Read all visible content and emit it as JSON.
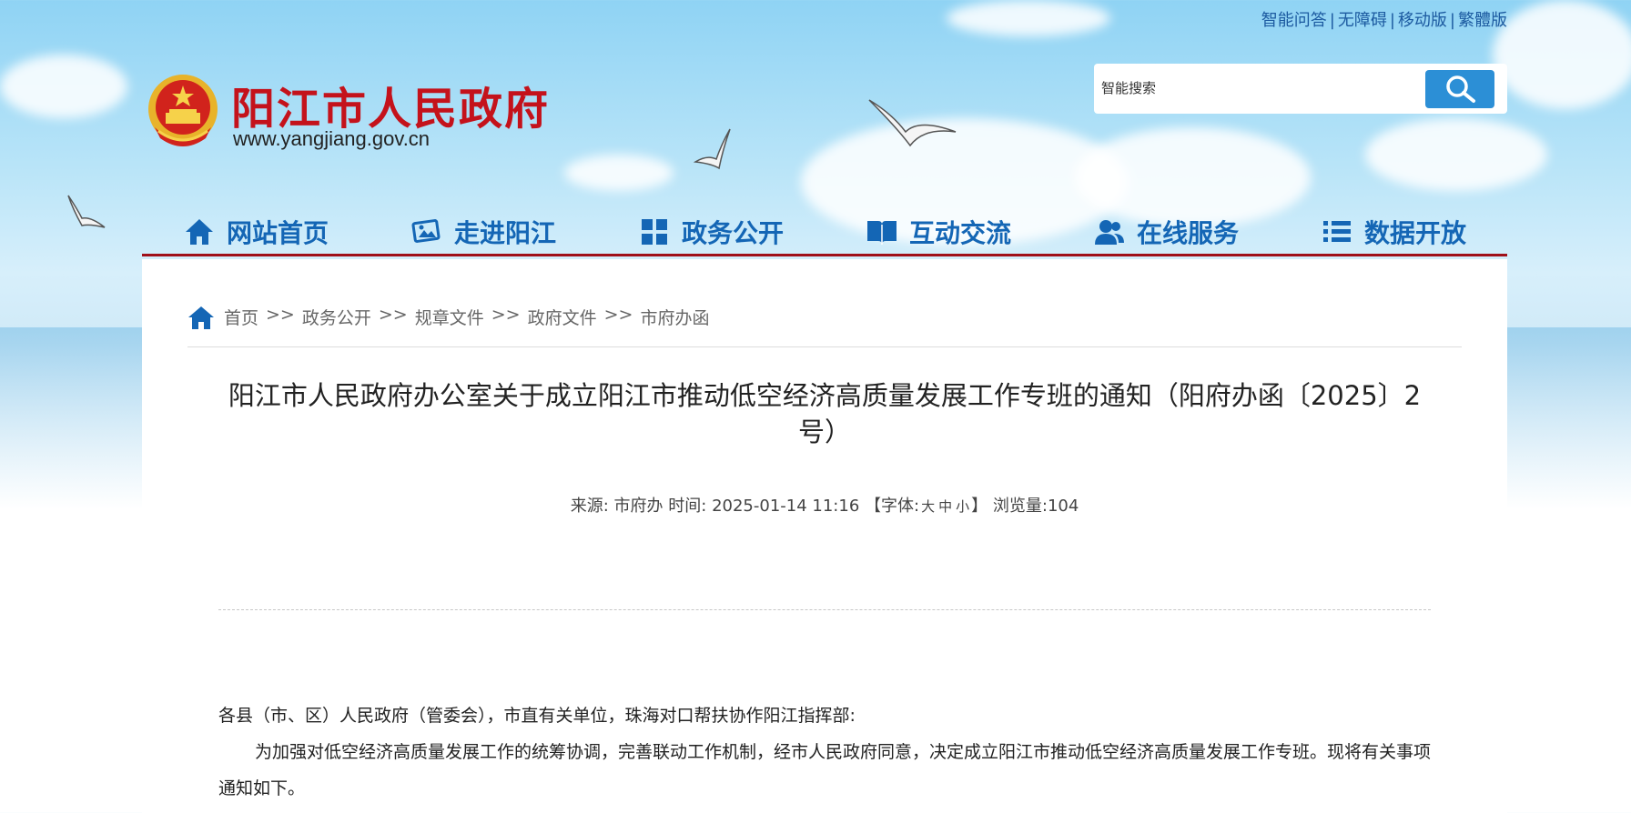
{
  "top_links": [
    "智能问答",
    "无障碍",
    "移动版",
    "繁體版"
  ],
  "header": {
    "site_name": "阳江市人民政府",
    "site_url": "www.yangjiang.gov.cn"
  },
  "search": {
    "placeholder": "智能搜索"
  },
  "nav": [
    {
      "label": "网站首页",
      "icon": "home-icon"
    },
    {
      "label": "走进阳江",
      "icon": "picture-icon"
    },
    {
      "label": "政务公开",
      "icon": "grid-icon"
    },
    {
      "label": "互动交流",
      "icon": "book-icon"
    },
    {
      "label": "在线服务",
      "icon": "users-icon"
    },
    {
      "label": "数据开放",
      "icon": "list-icon"
    }
  ],
  "breadcrumb": [
    "首页",
    "政务公开",
    "规章文件",
    "政府文件",
    "市府办函"
  ],
  "breadcrumb_sep": ">>",
  "article": {
    "title": "阳江市人民政府办公室关于成立阳江市推动低空经济高质量发展工作专班的通知（阳府办函〔2025〕2号）",
    "meta_source_label": "来源:",
    "meta_source": "市府办",
    "meta_time_label": "时间:",
    "meta_time": "2025-01-14 11:16",
    "meta_font_label": "【字体:",
    "font_sizes": [
      "大",
      "中",
      "小"
    ],
    "meta_font_close": "】",
    "meta_views_label": "浏览量:",
    "meta_views": "104",
    "salutation": "各县（市、区）人民政府（管委会），市直有关单位，珠海对口帮扶协作阳江指挥部:",
    "paragraph1": "为加强对低空经济高质量发展工作的统筹协调，完善联动工作机制，经市人民政府同意，决定成立阳江市推动低空经济高质量发展工作专班。现将有关事项通知如下。"
  },
  "colors": {
    "brand_red": "#c4121b",
    "nav_blue": "#1466b5",
    "nav_underline": "#a01019",
    "search_button": "#2c8fd6"
  }
}
